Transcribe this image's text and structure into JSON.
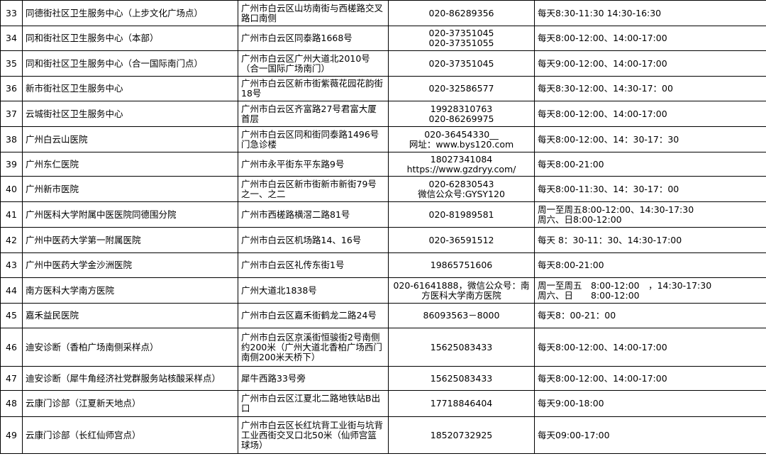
{
  "rows": [
    {
      "no": "33",
      "name": "同德街社区卫生服务中心（上步文化广场点）",
      "address": "广州市白云区山坊南街与西槎路交叉路口南侧",
      "phone": "020-86289356",
      "hours": "每天8:30-11:30 14:30-16:30"
    },
    {
      "no": "34",
      "name": "同和街社区卫生服务中心（本部）",
      "address": "广州市白云区同泰路1668号",
      "phone": "020-37351045\n020-37351055",
      "hours": "每天8:00-12:00、14:00-17:00"
    },
    {
      "no": "35",
      "name": "同和街社区卫生服务中心（合一国际南门点）",
      "address": "广州市白云区广州大道北2010号（合一国际广场南门）",
      "phone": "020-37351045",
      "hours": "每天9:00-12:00、14:00-17:00"
    },
    {
      "no": "36",
      "name": "新市街社区卫生服务中心",
      "address": "广州市白云区新市街紫薇花园花韵街18号",
      "phone": "020-32586577",
      "hours": "每天8:30-12:00、14:30-17：00"
    },
    {
      "no": "37",
      "name": "云城街社区卫生服务中心",
      "address": "广州市白云区齐富路27号君富大厦首层",
      "phone": "19928310763\n020-86269975",
      "hours": "每天8:00-12:00、14:00-17:00"
    },
    {
      "no": "38",
      "name": "广州白云山医院",
      "address": "广州市白云区同和街同泰路1496号门急诊楼",
      "phone": "020-36454330__\n网址：www.bys120.com",
      "hours": "每天8:00-12:00、14：30-17：30"
    },
    {
      "no": "39",
      "name": "广州东仁医院",
      "address": "广州市永平街东平东路9号",
      "phone": "18027341084\nhttps://www.gzdryy.com/",
      "hours": "每天8:00-21:00"
    },
    {
      "no": "40",
      "name": "广州新市医院",
      "address": "广州市白云区新市街新市新街79号之一、之二",
      "phone": "020-62830543\n微信公众号:GYSY120",
      "hours": "每天8:00-11:30、14：30-17：00"
    },
    {
      "no": "41",
      "name": "广州医科大学附属中医医院同德围分院",
      "address": "广州市西槎路横滘二路81号",
      "phone": "020-81989581",
      "hours": "周一至周五8:00-12:00、14:30-17:30\n周六、日8:00-12:00"
    },
    {
      "no": "42",
      "name": "广州中医药大学第一附属医院",
      "address": "广州市白云区机场路14、16号",
      "phone": "020-36591512",
      "hours": "每天 8：30-11：30、14:30-17:00"
    },
    {
      "no": "43",
      "name": "广州中医药大学金沙洲医院",
      "address": "广州市白云区礼传东街1号",
      "phone": "19865751606",
      "hours": "每天8:00-21:00"
    },
    {
      "no": "44",
      "name": "南方医科大学南方医院",
      "address": "广州大道北1838号",
      "phone": "020-61641888，微信公众号：南方医科大学南方医院",
      "hours": "周一至周五　8:00-12:00　，14:30-17:30\n周六、日　　8:00-12:00"
    },
    {
      "no": "45",
      "name": "嘉禾益民医院",
      "address": "广州市白云区嘉禾街鹤龙二路24号",
      "phone": "86093563－8000",
      "hours": "每天8：00-21：00"
    },
    {
      "no": "46",
      "name": "迪安诊断（香柏广场南侧采样点）",
      "address": "广州市白云区京溪街恒骏街2号南侧约200米（广州大道北香柏广场西门南侧200米天桥下）",
      "phone": "15625083433",
      "hours": "每天8:00-12:00、14:00-17:00"
    },
    {
      "no": "47",
      "name": "迪安诊断（犀牛角经济社党群服务站核酸采样点）",
      "address": "犀牛西路33号旁",
      "phone": "15625083433",
      "hours": "每天8:00-12:00、14:00-17:00"
    },
    {
      "no": "48",
      "name": "云康门诊部（江夏新天地点）",
      "address": "广州市白云区江夏北二路地铁站B出口",
      "phone": "17718846404",
      "hours": "每天9:00-18:00"
    },
    {
      "no": "49",
      "name": "云康门诊部（长红仙师宫点）",
      "address": "广州市白云区长红坑背工业街与坑背工业西街交叉口北50米（仙师宫篮球场）",
      "phone": "18520732925",
      "hours": "每天09:00-17:00"
    }
  ]
}
